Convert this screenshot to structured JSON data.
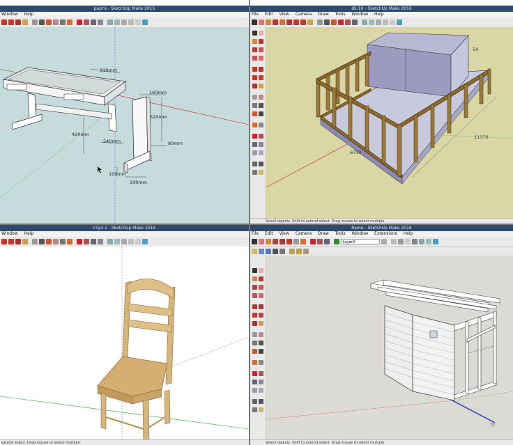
{
  "windows": {
    "table": {
      "title": "рарта - SketchUp Make 2016",
      "menu": [
        "Window",
        "Help"
      ],
      "dims": [
        "310mm",
        "160mm",
        "520mm",
        "420mm",
        "540mm",
        "80mm",
        "100mm",
        "500mm"
      ]
    },
    "house": {
      "title": "dk-10 - SketchUp Make 2016",
      "menu": [
        "File",
        "Edit",
        "View",
        "Camera",
        "Draw",
        "Tools",
        "Window",
        "Help"
      ],
      "dims": [
        "6750",
        "11370",
        "50"
      ],
      "status": "Select objects. Shift to extend select. Drag mouse to select multiple."
    },
    "chair": {
      "title": "стул-1 - SketchUp Make 2016",
      "menu": [
        "Window",
        "Help"
      ],
      "status": "extend select. Drag mouse to select multiple."
    },
    "shed": {
      "title": "Rame - SketchUp Make 2016",
      "menu": [
        "File",
        "Edit",
        "View",
        "Camera",
        "Draw",
        "Tools",
        "Window",
        "Extensions",
        "Help"
      ],
      "layer": "Layer0",
      "status": "Select objects. Shift to extend select. Drag mouse to select multiple."
    }
  },
  "icons": [
    "select-arrow-icon",
    "eraser-icon",
    "pencil-icon",
    "paint-bucket-icon",
    "orbit-icon",
    "pan-icon",
    "zoom-icon",
    "zoom-extents-icon",
    "rectangle-icon",
    "circle-icon",
    "move-icon",
    "rotate-icon",
    "scale-icon",
    "push-pull-icon",
    "offset-icon",
    "tape-measure-icon",
    "protractor-icon",
    "text-icon",
    "section-plane-icon",
    "walk-icon"
  ],
  "colors": {
    "titlebar": "#2f4a6e",
    "viewport_blue": "#c5dbdc",
    "viewport_cream": "#d9d7a6",
    "viewport_grey": "#dcdad5",
    "wood": "#d8b57b",
    "timber": "#8a6a2c",
    "axis_red": "#cc2222",
    "axis_green": "#22aa22",
    "axis_blue": "#2233cc"
  }
}
